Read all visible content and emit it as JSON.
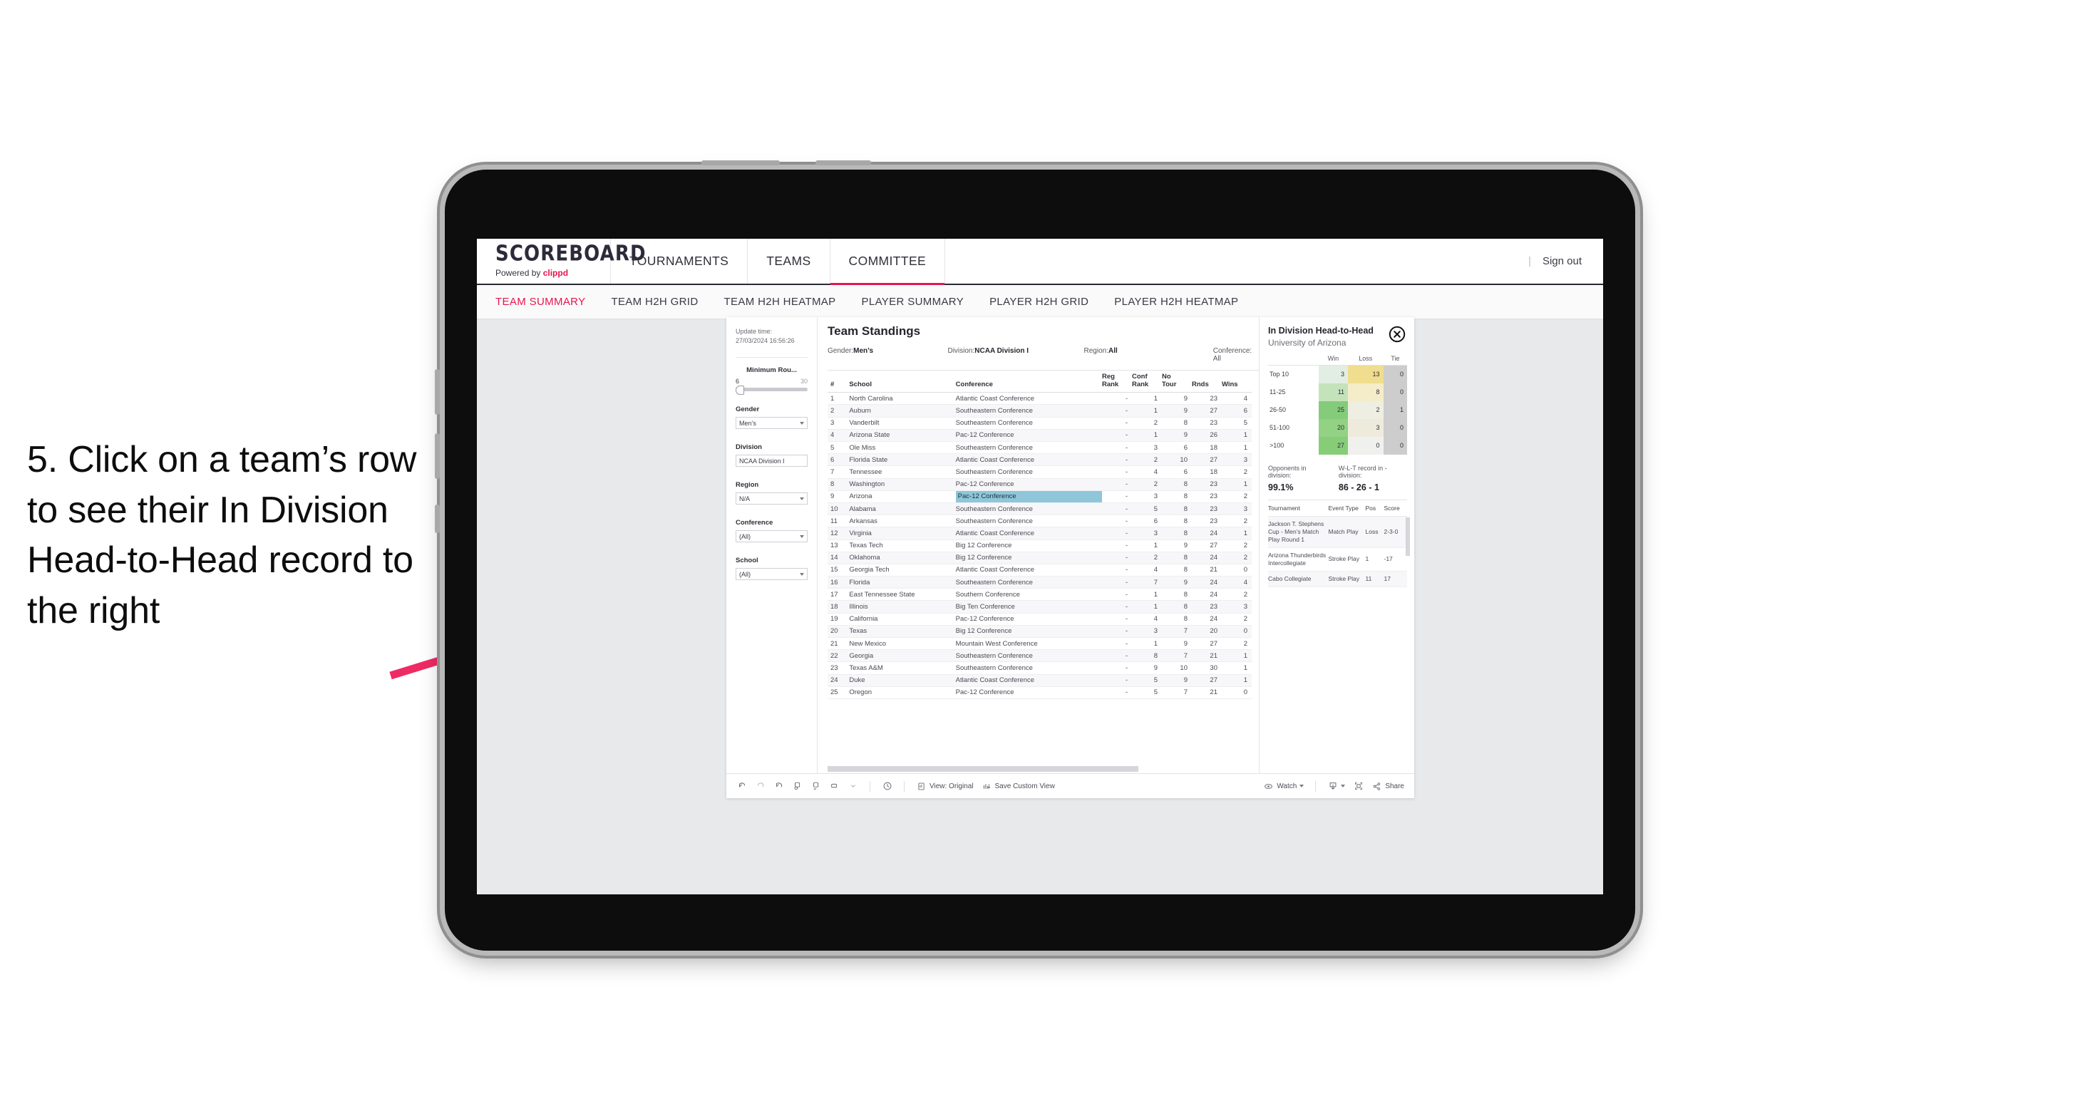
{
  "caption": "5. Click on a team’s row to see their In Division Head-to-Head record to the right",
  "header": {
    "logo_main": "SCOREBOARD",
    "logo_sub_prefix": "Powered by ",
    "logo_sub_brand": "clippd",
    "nav": [
      {
        "label": "TOURNAMENTS",
        "active": false
      },
      {
        "label": "TEAMS",
        "active": false
      },
      {
        "label": "COMMITTEE",
        "active": true
      }
    ],
    "divider": "|",
    "sign_out": "Sign out",
    "accent_color": "#e8154c"
  },
  "subnav": [
    {
      "label": "TEAM SUMMARY",
      "active": true
    },
    {
      "label": "TEAM H2H GRID",
      "active": false
    },
    {
      "label": "TEAM H2H HEATMAP",
      "active": false
    },
    {
      "label": "PLAYER SUMMARY",
      "active": false
    },
    {
      "label": "PLAYER H2H GRID",
      "active": false
    },
    {
      "label": "PLAYER H2H HEATMAP",
      "active": false
    }
  ],
  "filters": {
    "update_label": "Update time:",
    "update_time": "27/03/2024 16:56:26",
    "min_rounds": {
      "title": "Minimum Rou...",
      "low": "6",
      "high": "30"
    },
    "gender": {
      "title": "Gender",
      "value": "Men’s"
    },
    "division": {
      "title": "Division",
      "value": "NCAA Division I"
    },
    "region": {
      "title": "Region",
      "value": "N/A"
    },
    "conference": {
      "title": "Conference",
      "value": "(All)"
    },
    "school": {
      "title": "School",
      "value": "(All)"
    }
  },
  "standings": {
    "title": "Team Standings",
    "meta": {
      "gender_label": "Gender: ",
      "gender_value": "Men’s",
      "division_label": "Division: ",
      "division_value": "NCAA Division I",
      "region_label": "Region: ",
      "region_value": "All",
      "conference_label": "Conference: ",
      "conference_value": "All"
    },
    "columns": [
      "#",
      "School",
      "Conference",
      "Reg Rank",
      "Conf Rank",
      "No Tour",
      "Rnds",
      "Wins"
    ],
    "columns_wrapped": [
      {
        "l1": "#",
        "l2": ""
      },
      {
        "l1": "School",
        "l2": ""
      },
      {
        "l1": "Conference",
        "l2": ""
      },
      {
        "l1": "Reg",
        "l2": "Rank"
      },
      {
        "l1": "Conf",
        "l2": "Rank"
      },
      {
        "l1": "No",
        "l2": "Tour"
      },
      {
        "l1": "",
        "l2": "Rnds"
      },
      {
        "l1": "",
        "l2": "Wins"
      }
    ],
    "rows": [
      {
        "n": "1",
        "school": "North Carolina",
        "conf": "Atlantic Coast Conference",
        "reg": "-",
        "cr": "1",
        "nt": "9",
        "rnds": "23",
        "wins": "4",
        "sel": false
      },
      {
        "n": "2",
        "school": "Auburn",
        "conf": "Southeastern Conference",
        "reg": "-",
        "cr": "1",
        "nt": "9",
        "rnds": "27",
        "wins": "6",
        "sel": false
      },
      {
        "n": "3",
        "school": "Vanderbilt",
        "conf": "Southeastern Conference",
        "reg": "-",
        "cr": "2",
        "nt": "8",
        "rnds": "23",
        "wins": "5",
        "sel": false
      },
      {
        "n": "4",
        "school": "Arizona State",
        "conf": "Pac-12 Conference",
        "reg": "-",
        "cr": "1",
        "nt": "9",
        "rnds": "26",
        "wins": "1",
        "sel": false
      },
      {
        "n": "5",
        "school": "Ole Miss",
        "conf": "Southeastern Conference",
        "reg": "-",
        "cr": "3",
        "nt": "6",
        "rnds": "18",
        "wins": "1",
        "sel": false
      },
      {
        "n": "6",
        "school": "Florida State",
        "conf": "Atlantic Coast Conference",
        "reg": "-",
        "cr": "2",
        "nt": "10",
        "rnds": "27",
        "wins": "3",
        "sel": false
      },
      {
        "n": "7",
        "school": "Tennessee",
        "conf": "Southeastern Conference",
        "reg": "-",
        "cr": "4",
        "nt": "6",
        "rnds": "18",
        "wins": "2",
        "sel": false
      },
      {
        "n": "8",
        "school": "Washington",
        "conf": "Pac-12 Conference",
        "reg": "-",
        "cr": "2",
        "nt": "8",
        "rnds": "23",
        "wins": "1",
        "sel": false
      },
      {
        "n": "9",
        "school": "Arizona",
        "conf": "Pac-12 Conference",
        "reg": "-",
        "cr": "3",
        "nt": "8",
        "rnds": "23",
        "wins": "2",
        "sel": true
      },
      {
        "n": "10",
        "school": "Alabama",
        "conf": "Southeastern Conference",
        "reg": "-",
        "cr": "5",
        "nt": "8",
        "rnds": "23",
        "wins": "3",
        "sel": false
      },
      {
        "n": "11",
        "school": "Arkansas",
        "conf": "Southeastern Conference",
        "reg": "-",
        "cr": "6",
        "nt": "8",
        "rnds": "23",
        "wins": "2",
        "sel": false
      },
      {
        "n": "12",
        "school": "Virginia",
        "conf": "Atlantic Coast Conference",
        "reg": "-",
        "cr": "3",
        "nt": "8",
        "rnds": "24",
        "wins": "1",
        "sel": false
      },
      {
        "n": "13",
        "school": "Texas Tech",
        "conf": "Big 12 Conference",
        "reg": "-",
        "cr": "1",
        "nt": "9",
        "rnds": "27",
        "wins": "2",
        "sel": false
      },
      {
        "n": "14",
        "school": "Oklahoma",
        "conf": "Big 12 Conference",
        "reg": "-",
        "cr": "2",
        "nt": "8",
        "rnds": "24",
        "wins": "2",
        "sel": false
      },
      {
        "n": "15",
        "school": "Georgia Tech",
        "conf": "Atlantic Coast Conference",
        "reg": "-",
        "cr": "4",
        "nt": "8",
        "rnds": "21",
        "wins": "0",
        "sel": false
      },
      {
        "n": "16",
        "school": "Florida",
        "conf": "Southeastern Conference",
        "reg": "-",
        "cr": "7",
        "nt": "9",
        "rnds": "24",
        "wins": "4",
        "sel": false
      },
      {
        "n": "17",
        "school": "East Tennessee State",
        "conf": "Southern Conference",
        "reg": "-",
        "cr": "1",
        "nt": "8",
        "rnds": "24",
        "wins": "2",
        "sel": false
      },
      {
        "n": "18",
        "school": "Illinois",
        "conf": "Big Ten Conference",
        "reg": "-",
        "cr": "1",
        "nt": "8",
        "rnds": "23",
        "wins": "3",
        "sel": false
      },
      {
        "n": "19",
        "school": "California",
        "conf": "Pac-12 Conference",
        "reg": "-",
        "cr": "4",
        "nt": "8",
        "rnds": "24",
        "wins": "2",
        "sel": false
      },
      {
        "n": "20",
        "school": "Texas",
        "conf": "Big 12 Conference",
        "reg": "-",
        "cr": "3",
        "nt": "7",
        "rnds": "20",
        "wins": "0",
        "sel": false
      },
      {
        "n": "21",
        "school": "New Mexico",
        "conf": "Mountain West Conference",
        "reg": "-",
        "cr": "1",
        "nt": "9",
        "rnds": "27",
        "wins": "2",
        "sel": false
      },
      {
        "n": "22",
        "school": "Georgia",
        "conf": "Southeastern Conference",
        "reg": "-",
        "cr": "8",
        "nt": "7",
        "rnds": "21",
        "wins": "1",
        "sel": false
      },
      {
        "n": "23",
        "school": "Texas A&M",
        "conf": "Southeastern Conference",
        "reg": "-",
        "cr": "9",
        "nt": "10",
        "rnds": "30",
        "wins": "1",
        "sel": false
      },
      {
        "n": "24",
        "school": "Duke",
        "conf": "Atlantic Coast Conference",
        "reg": "-",
        "cr": "5",
        "nt": "9",
        "rnds": "27",
        "wins": "1",
        "sel": false
      },
      {
        "n": "25",
        "school": "Oregon",
        "conf": "Pac-12 Conference",
        "reg": "-",
        "cr": "5",
        "nt": "7",
        "rnds": "21",
        "wins": "0",
        "sel": false
      }
    ]
  },
  "h2h": {
    "title": "In Division Head-to-Head",
    "subtitle": "University of Arizona",
    "close_icon": "close-circle-icon",
    "columns": [
      "",
      "Win",
      "Loss",
      "Tie"
    ],
    "rows": [
      {
        "label": "Top 10",
        "win": "3",
        "loss": "13",
        "tie": "0",
        "win_color": "#e2eee3",
        "loss_color": "#f0dd8d",
        "tie_color": "#cdcdcd"
      },
      {
        "label": "11-25",
        "win": "11",
        "loss": "8",
        "tie": "0",
        "win_color": "#c5e3bb",
        "loss_color": "#f5ecc9",
        "tie_color": "#cdcdcd"
      },
      {
        "label": "26-50",
        "win": "25",
        "loss": "2",
        "tie": "1",
        "win_color": "#84cc7a",
        "loss_color": "#efeee2",
        "tie_color": "#cdcdcd"
      },
      {
        "label": "51-100",
        "win": "20",
        "loss": "3",
        "tie": "0",
        "win_color": "#93d184",
        "loss_color": "#eeebdc",
        "tie_color": "#cdcdcd"
      },
      {
        "label": ">100",
        "win": "27",
        "loss": "0",
        "tie": "0",
        "win_color": "#87cd78",
        "loss_color": "#f0f0ee",
        "tie_color": "#cdcdcd"
      }
    ],
    "stats": [
      {
        "label": "Opponents in division:",
        "value": "99.1%"
      },
      {
        "label": "W-L-T record in -division:",
        "value": "86 - 26 - 1"
      }
    ],
    "tournaments": {
      "columns": [
        "Tournament",
        "Event Type",
        "Pos",
        "Score"
      ],
      "rows": [
        {
          "name": "Jackson T. Stephens Cup - Men’s Match Play Round 1",
          "type": "Match Play",
          "pos": "Loss",
          "score": "2-3-0"
        },
        {
          "name": "Arizona Thunderbirds Intercollegiate",
          "type": "Stroke Play",
          "pos": "1",
          "score": "-17"
        },
        {
          "name": "Cabo Collegiate",
          "type": "Stroke Play",
          "pos": "11",
          "score": "17"
        }
      ]
    }
  },
  "toolbar": {
    "icons": [
      "undo-icon",
      "redo-icon",
      "revert-icon",
      "refresh-data-icon",
      "pause-icon",
      "highlight-icon"
    ],
    "clock_icon": "clock-icon",
    "view_label": "View: Original",
    "save_label": "Save Custom View",
    "watch_label": "Watch",
    "share_label": "Share",
    "download_icon": "download-icon",
    "fullscreen_icon": "fullscreen-icon"
  }
}
